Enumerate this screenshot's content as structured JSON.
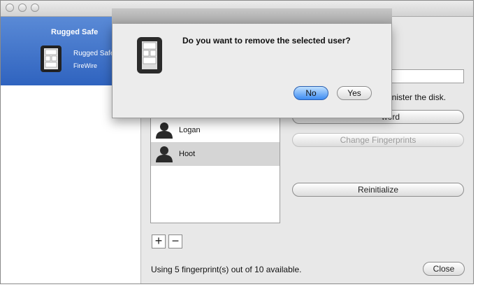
{
  "sidebar": {
    "group_title": "Rugged Safe",
    "device_name": "Rugged Safe",
    "device_interface": "FireWire"
  },
  "users": [
    {
      "name": "Logan"
    },
    {
      "name": "Hoot"
    }
  ],
  "actions": {
    "admin_text": "minister the disk.",
    "change_password_label": "word",
    "change_fingerprints_label": "Change Fingerprints",
    "reinitialize_label": "Reinitialize",
    "add_label": "+",
    "remove_label": "−"
  },
  "status_text": "Using 5 fingerprint(s) out of 10 available.",
  "close_label": "Close",
  "dialog": {
    "message": "Do you want to remove the selected user?",
    "no_label": "No",
    "yes_label": "Yes"
  },
  "colors": {
    "selection_blue": "#3a6fc9",
    "default_button": "#3d8cf2"
  }
}
